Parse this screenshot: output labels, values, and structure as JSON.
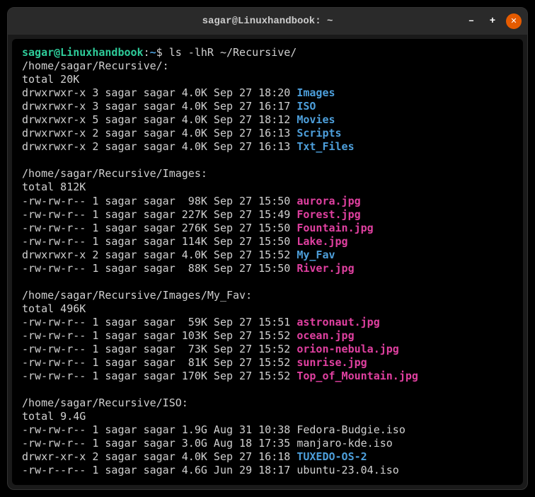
{
  "titlebar": {
    "title": "sagar@Linuxhandbook: ~"
  },
  "prompt": {
    "user_host": "sagar@Linuxhandbook",
    "colon": ":",
    "tilde": "~",
    "dollar": "$ ",
    "command": "ls -lhR ~/Recursive/"
  },
  "sections": [
    {
      "path": "/home/sagar/Recursive/:",
      "total": "total 20K",
      "entries": [
        {
          "meta": "drwxrwxr-x 3 sagar sagar 4.0K Sep 27 18:20 ",
          "name": "Images",
          "type": "dir"
        },
        {
          "meta": "drwxrwxr-x 3 sagar sagar 4.0K Sep 27 16:17 ",
          "name": "ISO",
          "type": "dir"
        },
        {
          "meta": "drwxrwxr-x 5 sagar sagar 4.0K Sep 27 18:12 ",
          "name": "Movies",
          "type": "dir"
        },
        {
          "meta": "drwxrwxr-x 2 sagar sagar 4.0K Sep 27 16:13 ",
          "name": "Scripts",
          "type": "dir"
        },
        {
          "meta": "drwxrwxr-x 2 sagar sagar 4.0K Sep 27 16:13 ",
          "name": "Txt_Files",
          "type": "dir"
        }
      ]
    },
    {
      "path": "/home/sagar/Recursive/Images:",
      "total": "total 812K",
      "entries": [
        {
          "meta": "-rw-rw-r-- 1 sagar sagar  98K Sep 27 15:50 ",
          "name": "aurora.jpg",
          "type": "img"
        },
        {
          "meta": "-rw-rw-r-- 1 sagar sagar 227K Sep 27 15:49 ",
          "name": "Forest.jpg",
          "type": "img"
        },
        {
          "meta": "-rw-rw-r-- 1 sagar sagar 276K Sep 27 15:50 ",
          "name": "Fountain.jpg",
          "type": "img"
        },
        {
          "meta": "-rw-rw-r-- 1 sagar sagar 114K Sep 27 15:50 ",
          "name": "Lake.jpg",
          "type": "img"
        },
        {
          "meta": "drwxrwxr-x 2 sagar sagar 4.0K Sep 27 15:52 ",
          "name": "My_Fav",
          "type": "dir"
        },
        {
          "meta": "-rw-rw-r-- 1 sagar sagar  88K Sep 27 15:50 ",
          "name": "River.jpg",
          "type": "img"
        }
      ]
    },
    {
      "path": "/home/sagar/Recursive/Images/My_Fav:",
      "total": "total 496K",
      "entries": [
        {
          "meta": "-rw-rw-r-- 1 sagar sagar  59K Sep 27 15:51 ",
          "name": "astronaut.jpg",
          "type": "img"
        },
        {
          "meta": "-rw-rw-r-- 1 sagar sagar 103K Sep 27 15:52 ",
          "name": "ocean.jpg",
          "type": "img"
        },
        {
          "meta": "-rw-rw-r-- 1 sagar sagar  73K Sep 27 15:52 ",
          "name": "orion-nebula.jpg",
          "type": "img"
        },
        {
          "meta": "-rw-rw-r-- 1 sagar sagar  81K Sep 27 15:52 ",
          "name": "sunrise.jpg",
          "type": "img"
        },
        {
          "meta": "-rw-rw-r-- 1 sagar sagar 170K Sep 27 15:52 ",
          "name": "Top_of_Mountain.jpg",
          "type": "img"
        }
      ]
    },
    {
      "path": "/home/sagar/Recursive/ISO:",
      "total": "total 9.4G",
      "entries": [
        {
          "meta": "-rw-rw-r-- 1 sagar sagar 1.9G Aug 31 10:38 ",
          "name": "Fedora-Budgie.iso",
          "type": "file"
        },
        {
          "meta": "-rw-rw-r-- 1 sagar sagar 3.0G Aug 18 17:35 ",
          "name": "manjaro-kde.iso",
          "type": "file"
        },
        {
          "meta": "drwxr-xr-x 2 sagar sagar 4.0K Sep 27 16:18 ",
          "name": "TUXEDO-OS-2",
          "type": "dir"
        },
        {
          "meta": "-rw-r--r-- 1 sagar sagar 4.6G Jun 29 18:17 ",
          "name": "ubuntu-23.04.iso",
          "type": "file"
        }
      ]
    }
  ]
}
